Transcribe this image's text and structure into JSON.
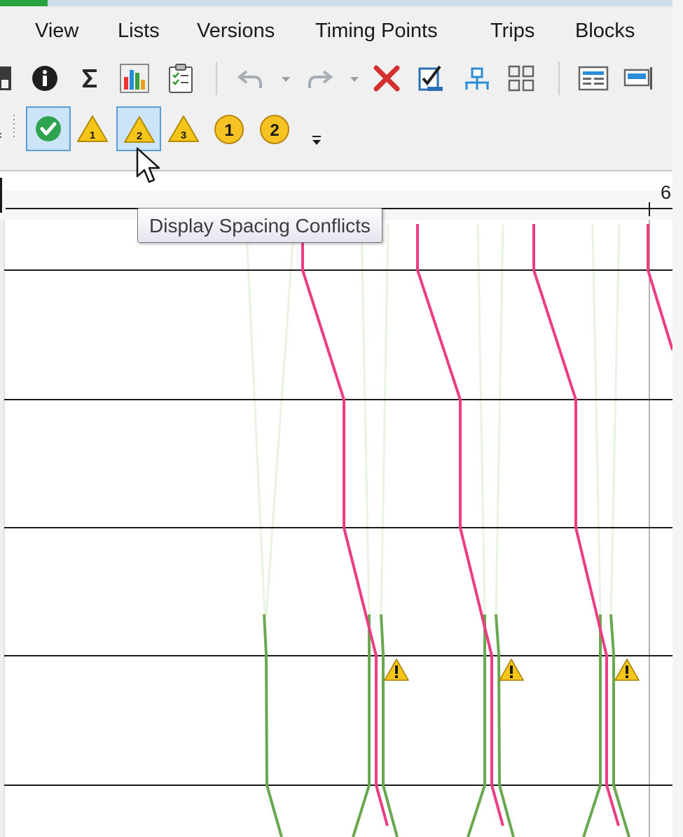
{
  "menu": {
    "items": [
      "View",
      "Lists",
      "Versions",
      "Timing Points",
      "Trips",
      "Blocks"
    ]
  },
  "toolbar_icons": [
    "save-icon",
    "info-icon",
    "sum-icon",
    "bar-chart-icon",
    "checklist-icon",
    "undo-icon",
    "redo-icon",
    "delete-icon",
    "check-task-icon",
    "network-icon",
    "grid-icon",
    "form-view-icon",
    "window-icon"
  ],
  "conflict_toolbar": {
    "badge_1": "1",
    "badge_2": "2",
    "warn_2": "2",
    "warn_3": "3",
    "warn_1": "1",
    "selected": [
      "display-valid-button",
      "display-spacing-conflicts-button"
    ]
  },
  "tooltip": {
    "text": "Display Spacing Conflicts"
  },
  "ruler": {
    "label": "6"
  },
  "colors": {
    "trip_line": "#ec3d82",
    "conflict_line": "#6aa84f",
    "faint_line": "#e8f3e3",
    "warning": "#f5c518",
    "selected_bg": "#cce4f7",
    "selected_border": "#5b9bd5"
  }
}
